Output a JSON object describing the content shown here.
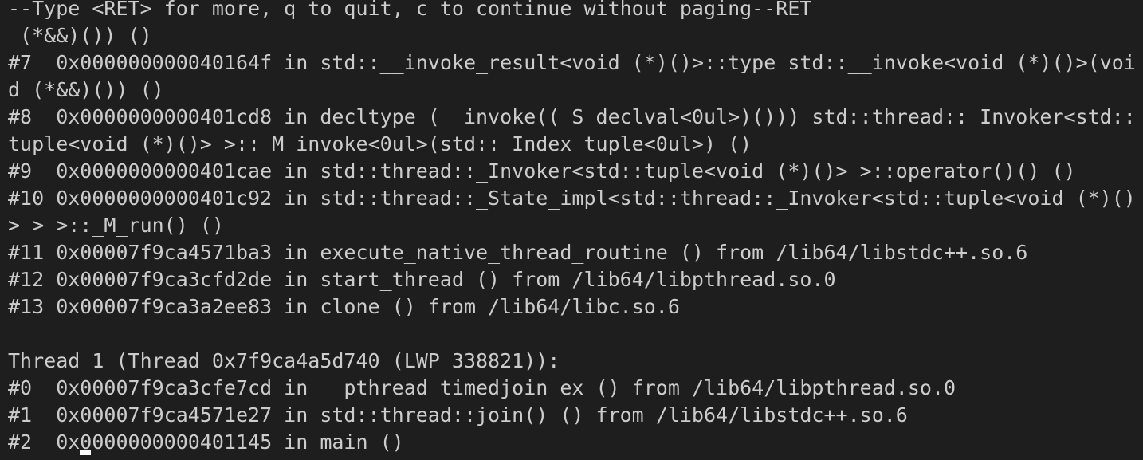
{
  "terminal": {
    "lines": [
      "--Type <RET> for more, q to quit, c to continue without paging--RET",
      " (*&&)()) ()",
      "#7  0x000000000040164f in std::__invoke_result<void (*)()>::type std::__invoke<void (*)()>(voi",
      "d (*&&)()) ()",
      "#8  0x0000000000401cd8 in decltype (__invoke((_S_declval<0ul>)())) std::thread::_Invoker<std::",
      "tuple<void (*)()> >::_M_invoke<0ul>(std::_Index_tuple<0ul>) ()",
      "#9  0x0000000000401cae in std::thread::_Invoker<std::tuple<void (*)()> >::operator()() ()",
      "#10 0x0000000000401c92 in std::thread::_State_impl<std::thread::_Invoker<std::tuple<void (*)()",
      "> > >::_M_run() ()",
      "#11 0x00007f9ca4571ba3 in execute_native_thread_routine () from /lib64/libstdc++.so.6",
      "#12 0x00007f9ca3cfd2de in start_thread () from /lib64/libpthread.so.0",
      "#13 0x00007f9ca3a2ee83 in clone () from /lib64/libc.so.6",
      "",
      "Thread 1 (Thread 0x7f9ca4a5d740 (LWP 338821)):",
      "#0  0x00007f9ca3cfe7cd in __pthread_timedjoin_ex () from /lib64/libpthread.so.0",
      "#1  0x00007f9ca4571e27 in std::thread::join() () from /lib64/libstdc++.so.6",
      "#2  0x0000000000401145 in main ()"
    ]
  },
  "colors": {
    "background": "#1e1e1e",
    "foreground": "#cccccc",
    "cursor": "#ffffff"
  }
}
